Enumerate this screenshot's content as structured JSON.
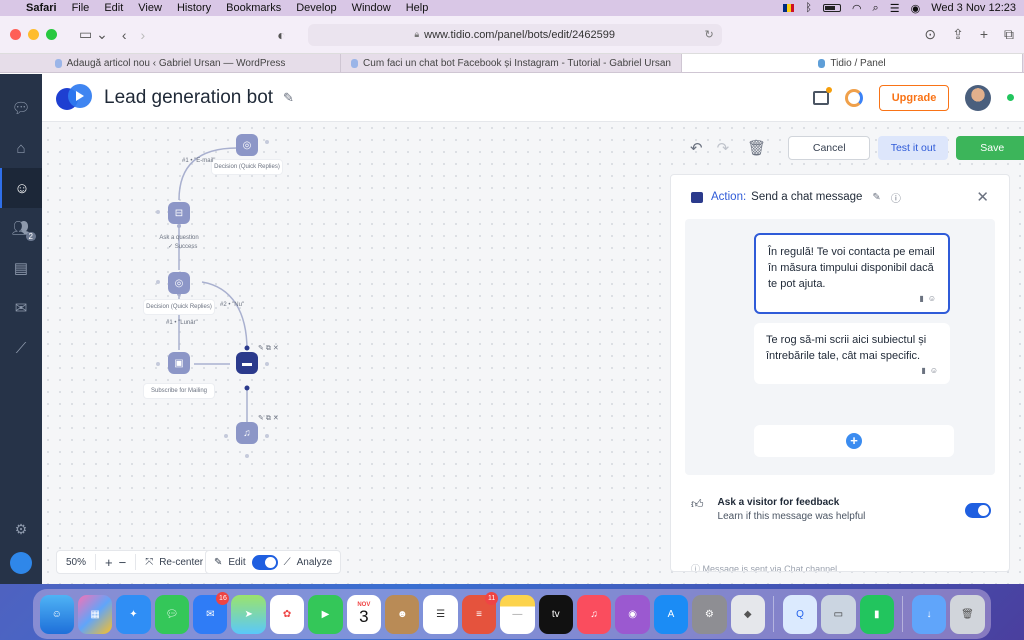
{
  "menubar": {
    "app": "Safari",
    "items": [
      "File",
      "Edit",
      "View",
      "History",
      "Bookmarks",
      "Develop",
      "Window",
      "Help"
    ],
    "datetime": "Wed 3 Nov  12:23"
  },
  "browser": {
    "url": "www.tidio.com/panel/bots/edit/2462599",
    "tabs": [
      {
        "title": "Adaugă articol nou ‹ Gabriel Ursan — WordPress"
      },
      {
        "title": "Cum faci un chat bot Facebook și Instagram - Tutorial - Gabriel Ursan"
      },
      {
        "title": "Tidio / Panel"
      }
    ]
  },
  "sidebar": {
    "contacts_badge": "2"
  },
  "header": {
    "bot_title": "Lead generation bot",
    "upgrade_label": "Upgrade"
  },
  "flow": {
    "nodes": [
      {
        "label": "Decision (Quick Replies)"
      },
      {
        "label": "Ask a question"
      },
      {
        "label": "Decision (Quick Replies)"
      },
      {
        "label": "Subscribe for Mailing"
      }
    ],
    "edges": {
      "email": "#1 • \"E-mail\"",
      "success": "✓ Success",
      "nu": "#2 • \"Nu\"",
      "lunar": "#1 • \"Lunar\""
    }
  },
  "canvas_controls": {
    "zoom": "50%",
    "recenter": "Re-center",
    "edit": "Edit",
    "analyze": "Analyze"
  },
  "actions": {
    "cancel": "Cancel",
    "test": "Test it out",
    "save": "Save"
  },
  "panel": {
    "kind": "Action:",
    "name": "Send a chat message",
    "messages": [
      "În regulă! Te voi contacta pe email în măsura timpului disponibil dacă te pot ajuta.",
      "Te rog să-mi scrii aici subiectul și întrebările tale, cât mai specific."
    ],
    "feedback_title": "Ask a visitor for feedback",
    "feedback_sub": "Learn if this message was helpful",
    "channel_note": "Message is sent via Chat channel"
  },
  "dock": {
    "mail_badge": "16",
    "todo_badge": "11",
    "calendar_month": "NOV",
    "calendar_day": "3"
  },
  "colors": {
    "primary": "#2f5bd8",
    "save": "#3cb55a",
    "upgrade": "#f97316",
    "sidebar": "#263348"
  }
}
